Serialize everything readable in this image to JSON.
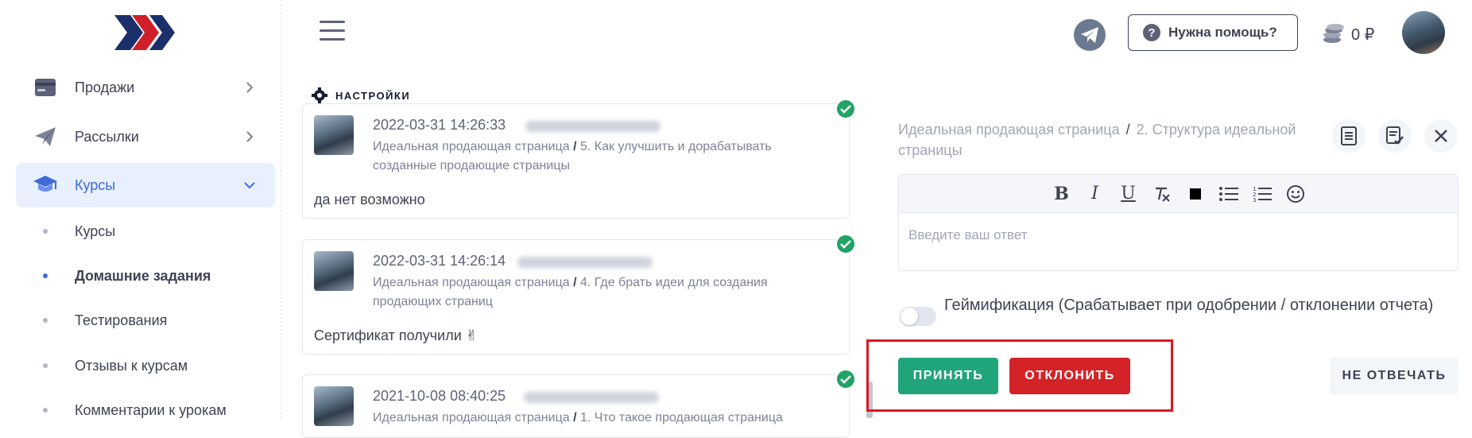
{
  "sidebar": {
    "items": [
      {
        "label": "Продажи"
      },
      {
        "label": "Рассылки"
      },
      {
        "label": "Курсы"
      }
    ],
    "sub_items": [
      {
        "label": "Курсы"
      },
      {
        "label": "Домашние задания"
      },
      {
        "label": "Тестирования"
      },
      {
        "label": "Отзывы к курсам"
      },
      {
        "label": "Комментарии к урокам"
      }
    ]
  },
  "header": {
    "help_label": "Нужна помощь?",
    "balance": "0 ₽"
  },
  "settings_label": "НАСТРОЙКИ",
  "cards": [
    {
      "datetime": "2022-03-31 14:26:33",
      "course": "Идеальная продающая страница",
      "lesson": "5. Как улучшить и дорабатывать созданные продающие страницы",
      "message": "да нет возможно"
    },
    {
      "datetime": "2022-03-31 14:26:14",
      "course": "Идеальная продающая страница",
      "lesson": "4. Где брать идеи для создания продающих страниц",
      "message": "Сертификат получили ✌"
    },
    {
      "datetime": "2021-10-08 08:40:25",
      "course": "Идеальная продающая страница",
      "lesson": "1. Что такое продающая страница"
    }
  ],
  "panel": {
    "course": "Идеальная продающая страница",
    "lesson": "2. Структура идеальной страницы",
    "separator": "/",
    "answer_placeholder": "Введите ваш ответ",
    "gamification_label": "Геймификация (Срабатывает при одобрении / отклонении отчета)",
    "accept_label": "ПРИНЯТЬ",
    "reject_label": "ОТКЛОНИТЬ",
    "skip_label": "НЕ ОТВЕЧАТЬ"
  },
  "colors": {
    "accent": "#3f6ad8",
    "accept": "#21a57b",
    "reject": "#d32328",
    "highlight_box": "#d81921"
  }
}
